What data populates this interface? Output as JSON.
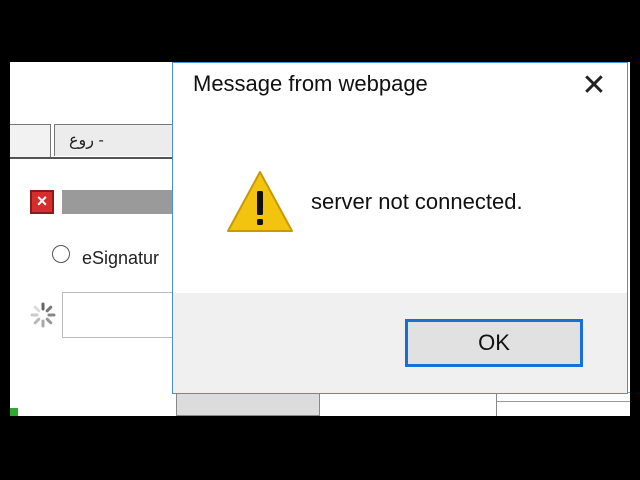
{
  "background_page": {
    "tab_arabic_label": "- روع",
    "radio_label": "eSignatur",
    "colors": {
      "error_icon": "#d62d2d",
      "status_green": "#2fa82f"
    }
  },
  "dialog": {
    "title": "Message from webpage",
    "close_glyph": "✕",
    "message": "server not connected.",
    "ok_label": "OK",
    "icon": "warning-icon",
    "colors": {
      "border": "#4a90d9",
      "button_focus": "#1a6fd6",
      "warning_fill": "#f2c40f"
    }
  }
}
